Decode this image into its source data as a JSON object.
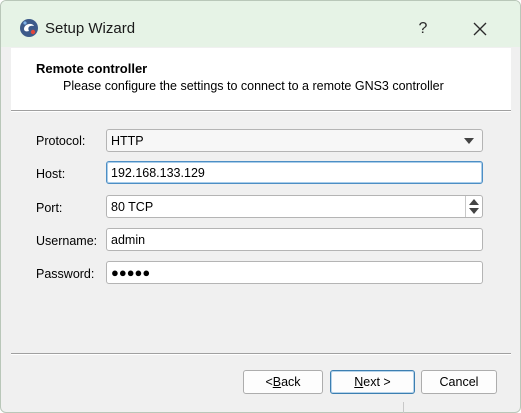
{
  "window": {
    "title": "Setup Wizard",
    "help_label": "?",
    "close_label": "✕"
  },
  "header": {
    "title": "Remote controller",
    "subtitle": "Please configure the settings to connect to a remote GNS3 controller"
  },
  "form": {
    "protocol": {
      "label": "Protocol:",
      "value": "HTTP"
    },
    "host": {
      "label": "Host:",
      "value": "192.168.133.129"
    },
    "port": {
      "label": "Port:",
      "value": "80 TCP"
    },
    "username": {
      "label": "Username:",
      "value": "admin"
    },
    "password": {
      "label": "Password:",
      "value": "●●●●●"
    }
  },
  "buttons": {
    "back_prefix": "< ",
    "back_mnemonic": "B",
    "back_rest": "ack",
    "next_mnemonic": "N",
    "next_rest": "ext >",
    "cancel": "Cancel"
  },
  "colors": {
    "titlebar": "#e6f3e6",
    "focus_border": "#4d8ec4"
  }
}
